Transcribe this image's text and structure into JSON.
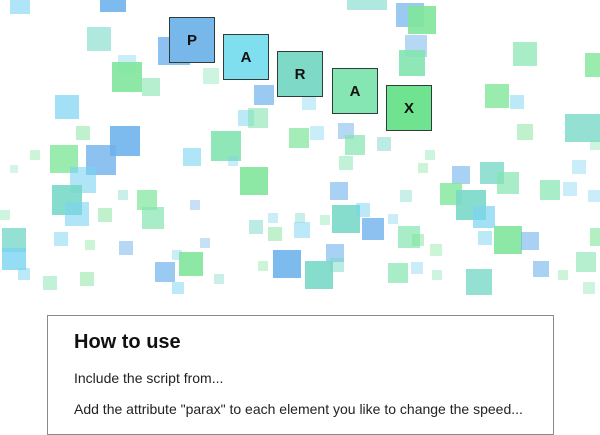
{
  "title_letters": [
    "P",
    "A",
    "R",
    "A",
    "X"
  ],
  "title_colors": [
    "#77b7ea",
    "#7fdfee",
    "#7fd9c7",
    "#86e6b3",
    "#6fe38f"
  ],
  "palette": [
    "#6fb2ec",
    "#7ad3f2",
    "#79d8c8",
    "#83e4b0",
    "#7fe69a"
  ],
  "usage": {
    "heading": "How to use",
    "line1": "Include the script from...",
    "line2": "Add the attribute \"parax\" to each element you like to change the speed..."
  }
}
